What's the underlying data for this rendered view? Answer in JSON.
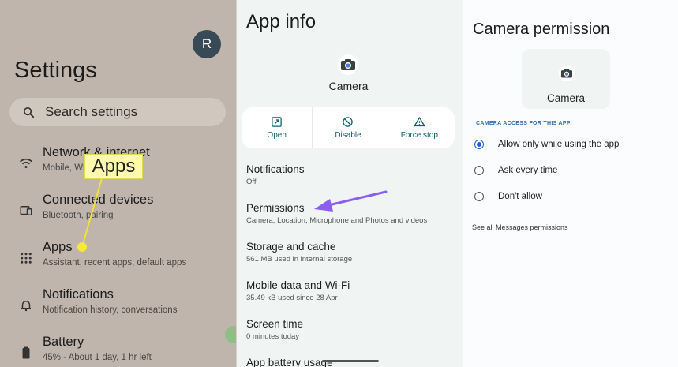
{
  "settings": {
    "avatar_initial": "R",
    "title": "Settings",
    "search_placeholder": "Search settings",
    "items": [
      {
        "label": "Network & internet",
        "sub": "Mobile, Wi",
        "icon": "wifi-icon"
      },
      {
        "label": "Connected devices",
        "sub": "Bluetooth, pairing",
        "icon": "devices-icon"
      },
      {
        "label": "Apps",
        "sub": "Assistant, recent apps, default apps",
        "icon": "apps-grid-icon"
      },
      {
        "label": "Notifications",
        "sub": "Notification history, conversations",
        "icon": "bell-icon"
      },
      {
        "label": "Battery",
        "sub": "45% - About 1 day, 1 hr left",
        "icon": "battery-icon"
      }
    ],
    "callout_label": "Apps",
    "callout_color": "#fff9b0"
  },
  "app_info": {
    "title": "App info",
    "app_name": "Camera",
    "actions": [
      {
        "label": "Open",
        "icon": "open-external-icon"
      },
      {
        "label": "Disable",
        "icon": "disable-icon"
      },
      {
        "label": "Force stop",
        "icon": "warning-icon"
      }
    ],
    "rows": [
      {
        "label": "Notifications",
        "sub": "Off"
      },
      {
        "label": "Permissions",
        "sub": "Camera, Location, Microphone and Photos and videos"
      },
      {
        "label": "Storage and cache",
        "sub": "561 MB used in internal storage"
      },
      {
        "label": "Mobile data and Wi-Fi",
        "sub": "35.49 kB used since 28 Apr"
      },
      {
        "label": "Screen time",
        "sub": "0 minutes today"
      },
      {
        "label": "App battery usage",
        "sub": ""
      }
    ],
    "arrow_color": "#8b5cf6"
  },
  "camera_permission": {
    "title": "Camera permission",
    "app_name": "Camera",
    "section_header": "CAMERA ACCESS FOR THIS APP",
    "options": [
      {
        "label": "Allow only while using the app",
        "selected": true
      },
      {
        "label": "Ask every time",
        "selected": false
      },
      {
        "label": "Don't allow",
        "selected": false
      }
    ],
    "see_all_link": "See all Messages permissions",
    "accent_color": "#1f63c4"
  }
}
